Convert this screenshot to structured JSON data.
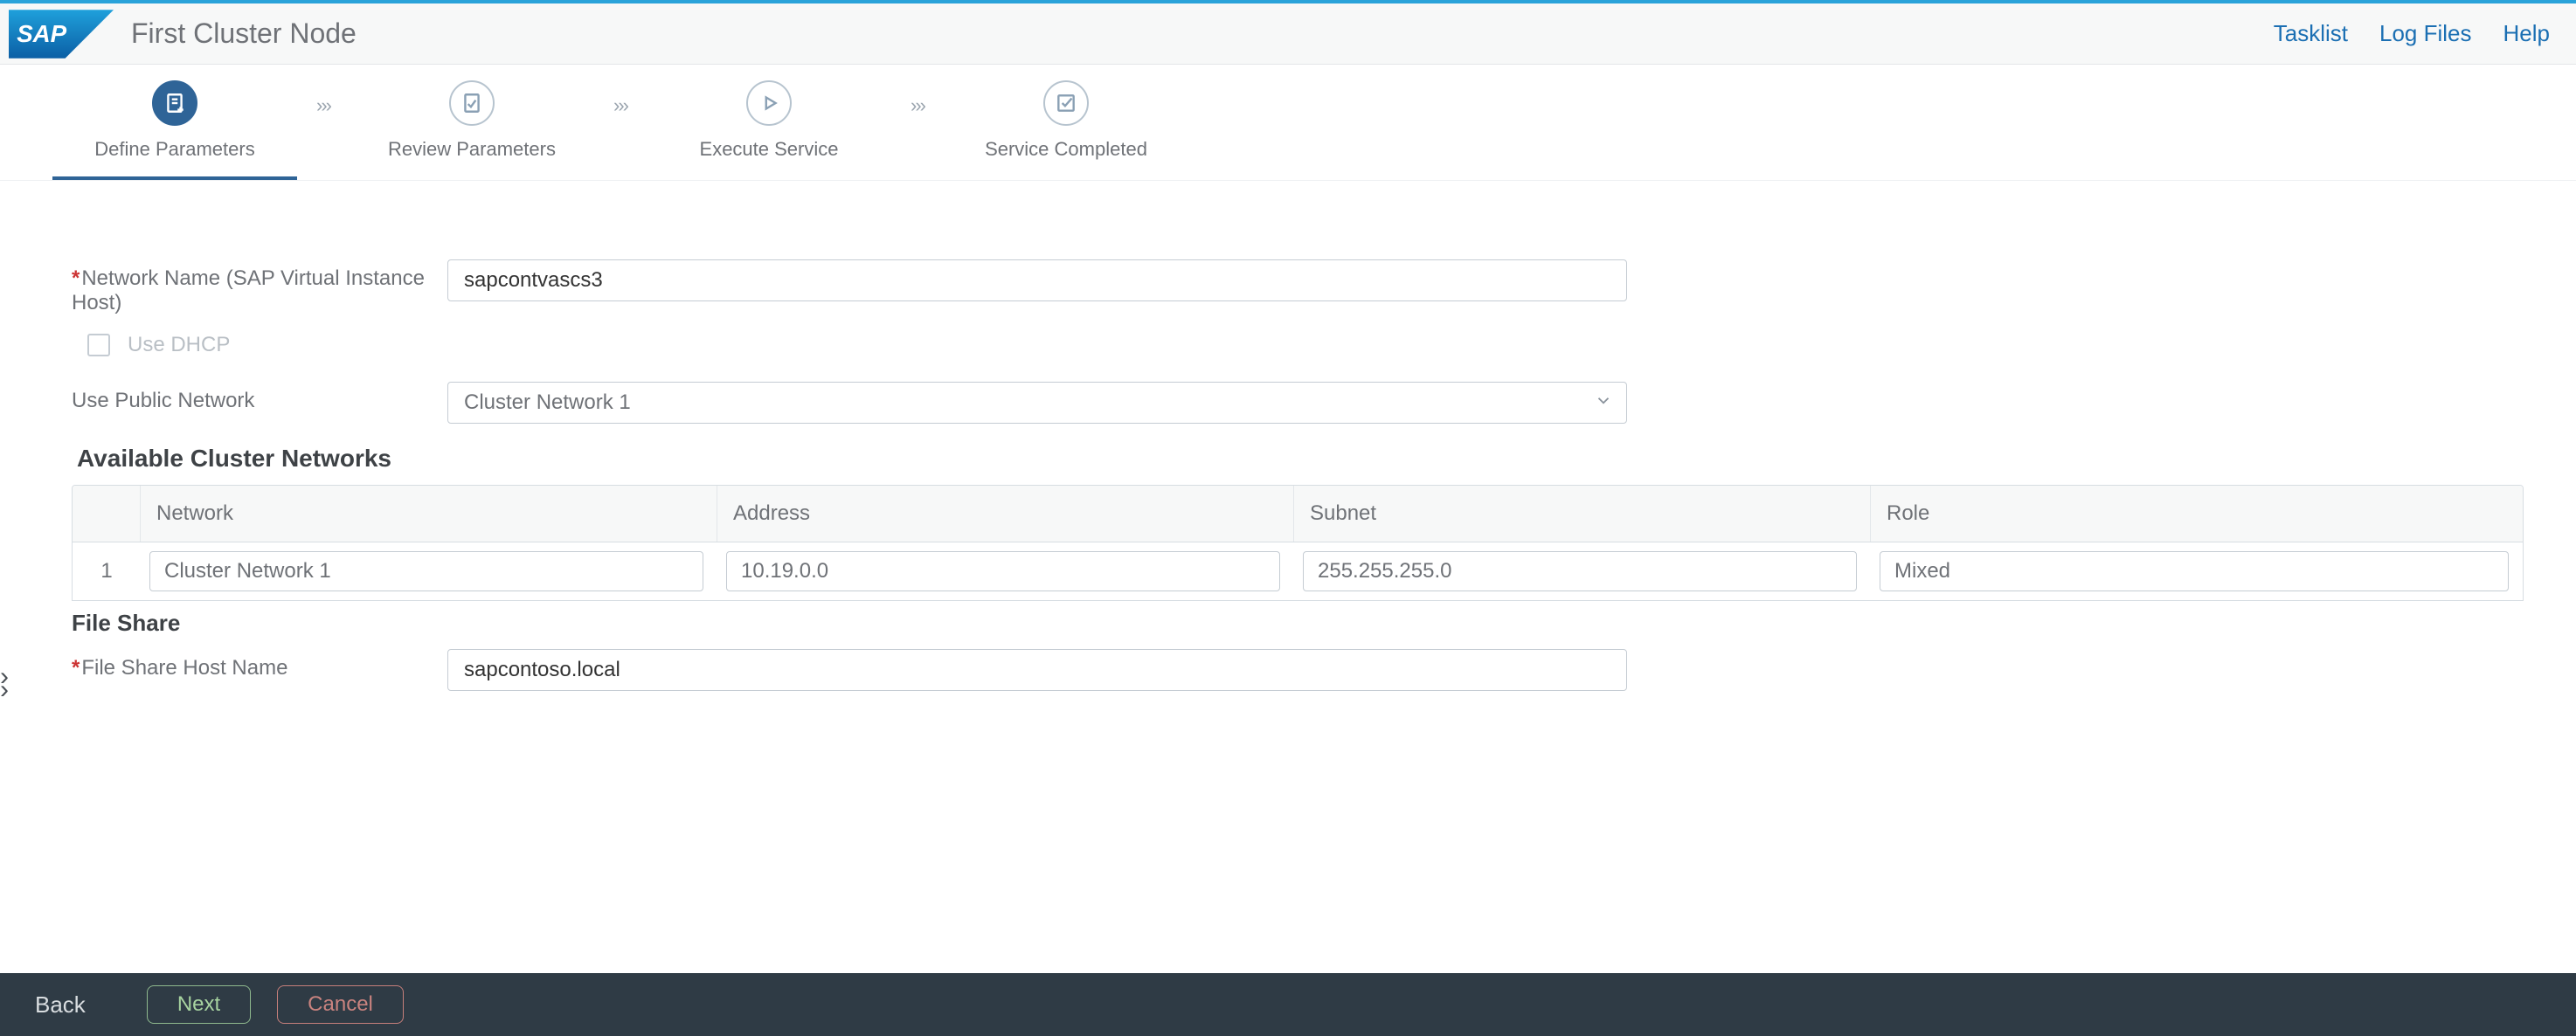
{
  "header": {
    "title": "First Cluster Node",
    "links": {
      "tasklist": "Tasklist",
      "logfiles": "Log Files",
      "help": "Help"
    }
  },
  "wizard": {
    "steps": [
      {
        "label": "Define Parameters"
      },
      {
        "label": "Review Parameters"
      },
      {
        "label": "Execute Service"
      },
      {
        "label": "Service Completed"
      }
    ],
    "sep": "›››"
  },
  "form": {
    "network_name_label": "Network Name (SAP Virtual Instance Host)",
    "network_name_value": "sapcontvascs3",
    "use_dhcp_label": "Use DHCP",
    "use_public_network_label": "Use Public Network",
    "use_public_network_value": "Cluster Network 1",
    "available_networks_heading": "Available Cluster Networks",
    "file_share_heading": "File Share",
    "file_share_host_label": "File Share Host Name",
    "file_share_host_value": "sapcontoso.local"
  },
  "table": {
    "headers": {
      "network": "Network",
      "address": "Address",
      "subnet": "Subnet",
      "role": "Role"
    },
    "rows": [
      {
        "idx": "1",
        "network": "Cluster Network 1",
        "address": "10.19.0.0",
        "subnet": "255.255.255.0",
        "role": "Mixed"
      }
    ]
  },
  "footer": {
    "back": "Back",
    "next": "Next",
    "cancel": "Cancel"
  }
}
